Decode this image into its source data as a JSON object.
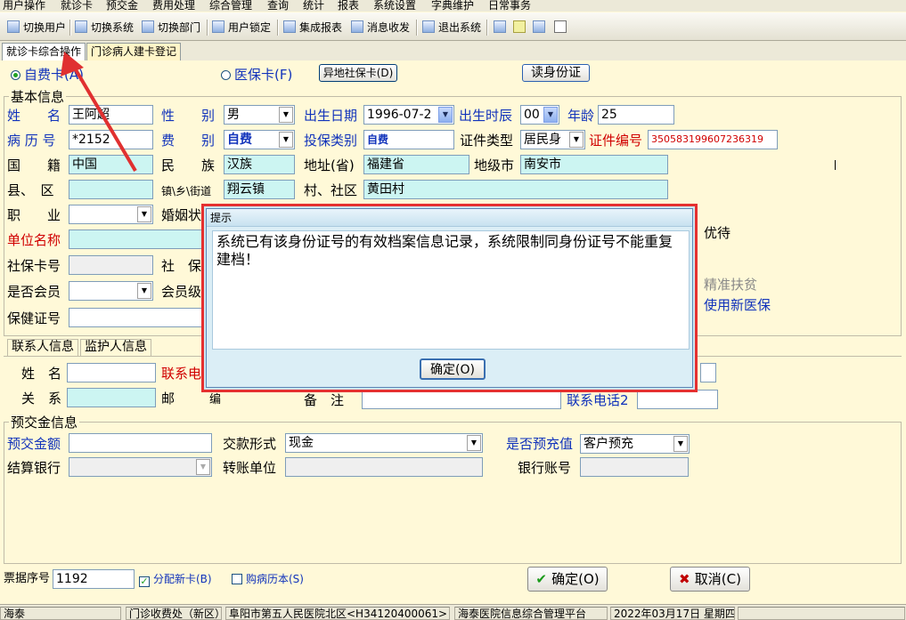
{
  "menu": [
    "用户操作",
    "就诊卡",
    "预交金",
    "费用处理",
    "综合管理",
    "查询",
    "统计",
    "报表",
    "系统设置",
    "字典维护",
    "日常事务"
  ],
  "toolbar": {
    "switch_user": "切换用户",
    "switch_system": "切换系统",
    "switch_dept": "切换部门",
    "user_lock": "用户锁定",
    "report": "集成报表",
    "messages": "消息收发",
    "exit": "退出系统"
  },
  "tabs": [
    "就诊卡综合操作",
    "门诊病人建卡登记"
  ],
  "card_type": {
    "self_pay": "自费卡(A)",
    "insurance": "医保卡(F)",
    "remote_insurance_btn": "异地社保卡(D)",
    "read_id_btn": "读身份证"
  },
  "basic": {
    "section_title": "基本信息",
    "name_label": "姓　　名",
    "name_value": "王阿超",
    "gender_label": "性　　别",
    "gender_value": "男",
    "birth_date_label": "出生日期",
    "birth_date_value": "1996-07-2",
    "birth_hour_label": "出生时辰",
    "birth_hour_value": "00",
    "age_label": "年龄",
    "age_value": "25",
    "record_no_label": "病 历 号",
    "record_no_value": "*2152",
    "fee_type_label": "费　　别",
    "fee_type_value": "自费",
    "insure_type_label": "投保类别",
    "insure_type_value": "自费",
    "id_type_label": "证件类型",
    "id_type_value": "居民身",
    "id_no_label": "证件编号",
    "id_no_value": "350583199607236319",
    "nationality_label": "国　　籍",
    "nationality_value": "中国",
    "ethnic_label": "民　　族",
    "ethnic_value": "汉族",
    "province_label": "地址(省)",
    "province_value": "福建省",
    "city_label": "地级市",
    "city_value": "南安市",
    "county_label": "县、　区",
    "town_label": "镇\\乡\\街道",
    "town_value": "翔云镇",
    "village_label": "村、社区",
    "village_value": "黄田村",
    "job_label": "职　　业",
    "marriage_label": "婚姻状",
    "employer_label": "单位名称",
    "social_card_label": "社保卡号",
    "social_label2": "社　保",
    "member_label": "是否会员",
    "member_level_label": "会员级",
    "health_cert_label": "保健证号",
    "preferential_label": "优待",
    "poverty_label": "精准扶贫",
    "new_insurance_label": "使用新医保"
  },
  "contact_tabs": [
    "联系人信息",
    "监护人信息"
  ],
  "contact": {
    "name_label": "姓　名",
    "contact_phone_label": "联系电",
    "relation_label": "关　系",
    "postal_label": "邮",
    "code_label": "编",
    "remark_label": "备　注",
    "phone2_label": "联系电话2"
  },
  "deposit": {
    "section_title": "预交金信息",
    "amount_label": "预交金额",
    "pay_form_label": "交款形式",
    "pay_form_value": "现金",
    "prefill_label": "是否预充值",
    "prefill_value": "客户预充",
    "bank_label": "结算银行",
    "transfer_label": "转账单位",
    "account_label": "银行账号"
  },
  "bottom": {
    "ticket_no_label": "票据序号",
    "ticket_no_value": "1192",
    "assign_card_label": "分配新卡(B)",
    "buy_record_label": "购病历本(S)",
    "ok_btn": "确定(O)",
    "cancel_btn": "取消(C)"
  },
  "dialog": {
    "title": "提示",
    "message": "系统已有该身份证号的有效档案信息记录，系统限制同身份证号不能重复建档！",
    "ok_btn": "确定(O)"
  },
  "status_bar": [
    "海泰",
    "门诊收费处（新区）",
    "阜阳市第五人民医院北区<H34120400061>",
    "海泰医院信息综合管理平台",
    "2022年03月17日 星期四"
  ],
  "colors": {
    "label_blue": "#1133bb",
    "label_red": "#d00000",
    "dialog_highlight": "#e53030",
    "readonly_field": "#ccf5f2"
  }
}
